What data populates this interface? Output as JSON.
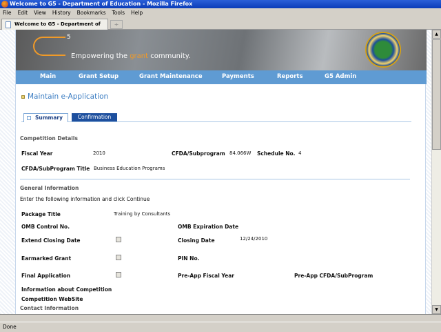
{
  "window": {
    "title": "Welcome to G5 - Department of Education - Mozilla Firefox"
  },
  "menu": [
    "File",
    "Edit",
    "View",
    "History",
    "Bookmarks",
    "Tools",
    "Help"
  ],
  "browser_tab": {
    "label": "Welcome to G5 - Department of Edu...",
    "new_tab": "+"
  },
  "banner": {
    "logo": "G5",
    "logo_sup": "5",
    "tagline_pre": "Empowering the ",
    "tagline_accent": "grant",
    "tagline_post": " community."
  },
  "nav": [
    "Main",
    "Grant Setup",
    "Grant Maintenance",
    "Payments",
    "Reports",
    "G5 Admin"
  ],
  "page_title": "Maintain e-Application",
  "tabs": [
    "Summary",
    "Confirmation"
  ],
  "competition": {
    "heading": "Competition Details",
    "fiscal_year_label": "Fiscal Year",
    "fiscal_year": "2010",
    "cfda_label": "CFDA/Subprogram",
    "cfda": "84.066W",
    "schedule_label": "Schedule No.",
    "schedule": "4",
    "title_label": "CFDA/SubProgram Title",
    "title": "Business Education Programs"
  },
  "general": {
    "heading": "General Information",
    "instructions": "Enter the following information and click Continue",
    "package_title_label": "Package Title",
    "package_title": "Training by Consultants",
    "omb_control_label": "OMB Control No.",
    "omb_exp_label": "OMB Expiration Date",
    "extend_label": "Extend Closing Date",
    "closing_label": "Closing Date",
    "closing_date": "12/24/2010",
    "earmarked_label": "Earmarked Grant",
    "pin_label": "PIN No.",
    "final_label": "Final Application",
    "preapp_fy_label": "Pre-App Fiscal Year",
    "preapp_cfda_label": "Pre-App CFDA/SubProgram",
    "info_label": "Information about Competition",
    "website_label": "Competition WebSite",
    "extend_checked": false,
    "earmarked_checked": false,
    "final_checked": false
  },
  "contact": {
    "heading": "Contact Information"
  },
  "status": "Done",
  "colors": {
    "nav": "#5f9bd3",
    "accent": "#f09a28",
    "title": "#3a7cc2",
    "active_tab": "#1d4f9e"
  }
}
